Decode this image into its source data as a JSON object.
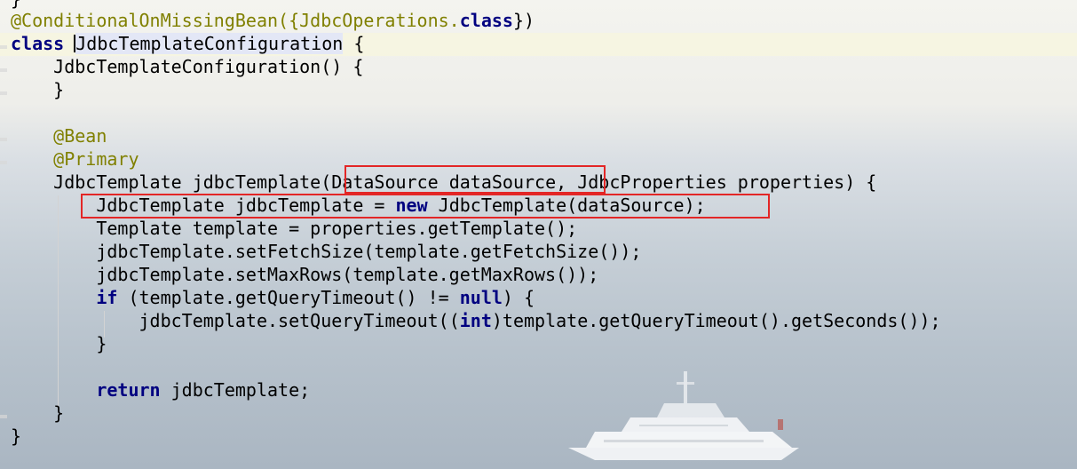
{
  "code": {
    "top_partial": "}",
    "annotation_conditional": "@ConditionalOnMissingBean({JdbcOperations.",
    "annotation_class_kw": "class",
    "annotation_close": "})",
    "class_kw": "class",
    "class_name": "JdbcTemplateConfiguration",
    "class_open": " {",
    "ctor": "JdbcTemplateConfiguration() {",
    "ctor_close": "}",
    "bean": "@Bean",
    "primary": "@Primary",
    "method_sig_start": "JdbcTemplate jdbcTemplate",
    "method_param1": "(DataSource dataSource",
    "method_sig_rest": ", JdbcProperties properties) {",
    "line_new_start": "JdbcTemplate jdbcTemplate = ",
    "line_new_kw": "new",
    "line_new_end": " JdbcTemplate(dataSource);",
    "line_template": "Template template = properties.getTemplate();",
    "line_fetch": "jdbcTemplate.setFetchSize(template.getFetchSize());",
    "line_maxrows": "jdbcTemplate.setMaxRows(template.getMaxRows());",
    "if_kw": "if",
    "if_mid": " (template.getQueryTimeout() != ",
    "null_kw": "null",
    "if_end": ") {",
    "timeout_start": "jdbcTemplate.setQueryTimeout((",
    "int_kw": "int",
    "timeout_end": ")template.getQueryTimeout().getSeconds());",
    "if_close": "}",
    "return_kw": "return",
    "return_rest": " jdbcTemplate;",
    "method_close": "}",
    "class_close": "}"
  },
  "colors": {
    "keyword": "#000080",
    "annotation": "#808000",
    "highlight_box": "#e32626"
  }
}
